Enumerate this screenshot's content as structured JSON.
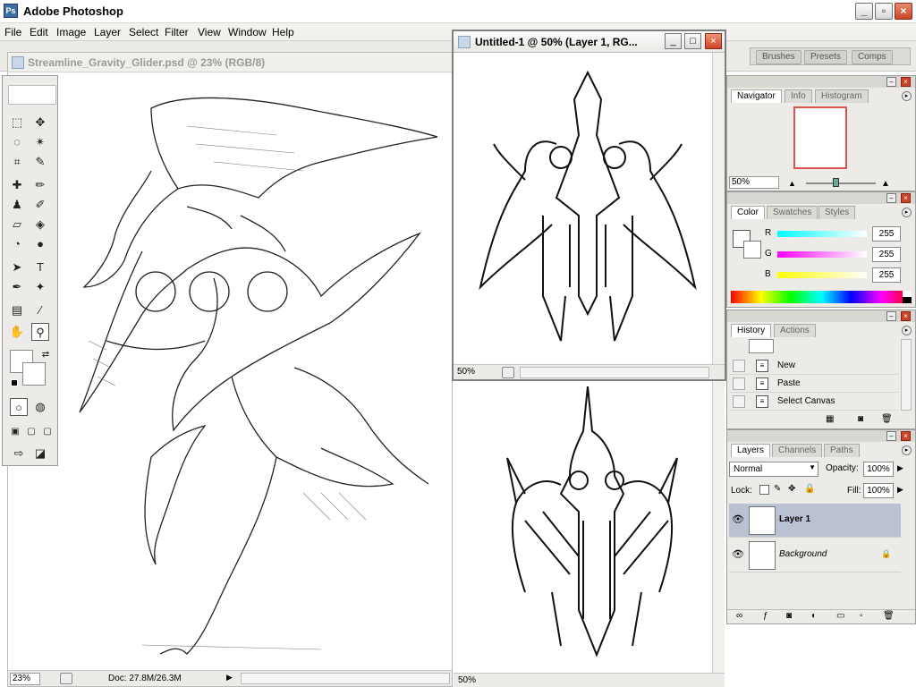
{
  "app": {
    "title": "Adobe Photoshop"
  },
  "menu": [
    "File",
    "Edit",
    "Image",
    "Layer",
    "Select",
    "Filter",
    "View",
    "Window",
    "Help"
  ],
  "wells": [
    "Brushes",
    "Presets",
    "Comps"
  ],
  "doc1": {
    "title": "Streamline_Gravity_Glider.psd @ 23% (RGB/8)",
    "zoom": "23%",
    "doc_info": "Doc: 27.8M/26.3M"
  },
  "doc2": {
    "title": "Untitled-1 @ 50% (Layer 1, RG...",
    "zoom": "50%"
  },
  "doc3": {
    "zoom": "50%"
  },
  "navigator": {
    "tabs": [
      "Navigator",
      "Info",
      "Histogram"
    ],
    "zoom": "50%"
  },
  "color": {
    "tabs": [
      "Color",
      "Swatches",
      "Styles"
    ],
    "channels": [
      "R",
      "G",
      "B"
    ],
    "values": [
      "255",
      "255",
      "255"
    ]
  },
  "history": {
    "tabs": [
      "History",
      "Actions"
    ],
    "items": [
      "New",
      "Paste",
      "Select Canvas"
    ]
  },
  "layers": {
    "tabs": [
      "Layers",
      "Channels",
      "Paths"
    ],
    "blend_mode": "Normal",
    "opacity_label": "Opacity:",
    "opacity": "100%",
    "lock_label": "Lock:",
    "fill_label": "Fill:",
    "fill": "100%",
    "items": [
      "Layer 1",
      "Background"
    ]
  }
}
